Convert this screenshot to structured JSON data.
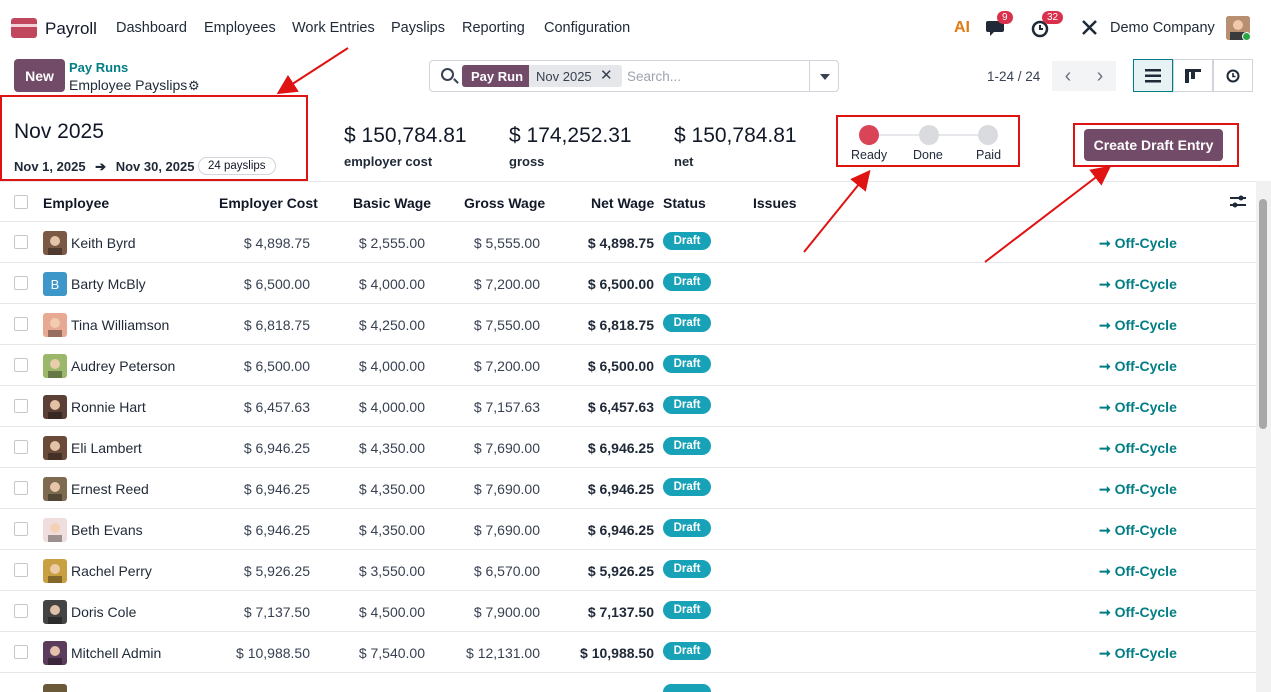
{
  "navbar": {
    "app_name": "Payroll",
    "menu": [
      "Dashboard",
      "Employees",
      "Work Entries",
      "Payslips",
      "Reporting",
      "Configuration"
    ],
    "ai_label": "AI",
    "messages_count": "9",
    "activities_count": "32",
    "company": "Demo Company"
  },
  "control": {
    "new_label": "New",
    "breadcrumb_parent": "Pay Runs",
    "breadcrumb_current": "Employee Payslips",
    "facet_label": "Pay Run",
    "facet_value": "Nov 2025",
    "search_placeholder": "Search...",
    "pager": "1-24 / 24"
  },
  "summary": {
    "title": "Nov 2025",
    "start_date": "Nov 1, 2025",
    "end_date": "Nov 30, 2025",
    "payslip_count": "24 payslips",
    "employer_cost_value": "$ 150,784.81",
    "employer_cost_label": "employer cost",
    "gross_value": "$ 174,252.31",
    "gross_label": "gross",
    "net_value": "$ 150,784.81",
    "net_label": "net",
    "states": [
      "Ready",
      "Done",
      "Paid"
    ],
    "active_state": "Ready",
    "create_draft_label": "Create Draft Entry"
  },
  "table": {
    "columns": [
      "Employee",
      "Employer Cost",
      "Basic Wage",
      "Gross Wage",
      "Net Wage",
      "Status",
      "Issues"
    ],
    "rows": [
      {
        "employee": "Keith Byrd",
        "employer_cost": "$ 4,898.75",
        "basic": "$ 2,555.00",
        "gross": "$ 5,555.00",
        "net": "$ 4,898.75",
        "status": "Draft",
        "action": "Off-Cycle"
      },
      {
        "employee": "Barty McBly",
        "employer_cost": "$ 6,500.00",
        "basic": "$ 4,000.00",
        "gross": "$ 7,200.00",
        "net": "$ 6,500.00",
        "status": "Draft",
        "action": "Off-Cycle",
        "initial": "B"
      },
      {
        "employee": "Tina Williamson",
        "employer_cost": "$ 6,818.75",
        "basic": "$ 4,250.00",
        "gross": "$ 7,550.00",
        "net": "$ 6,818.75",
        "status": "Draft",
        "action": "Off-Cycle"
      },
      {
        "employee": "Audrey Peterson",
        "employer_cost": "$ 6,500.00",
        "basic": "$ 4,000.00",
        "gross": "$ 7,200.00",
        "net": "$ 6,500.00",
        "status": "Draft",
        "action": "Off-Cycle"
      },
      {
        "employee": "Ronnie Hart",
        "employer_cost": "$ 6,457.63",
        "basic": "$ 4,000.00",
        "gross": "$ 7,157.63",
        "net": "$ 6,457.63",
        "status": "Draft",
        "action": "Off-Cycle"
      },
      {
        "employee": "Eli Lambert",
        "employer_cost": "$ 6,946.25",
        "basic": "$ 4,350.00",
        "gross": "$ 7,690.00",
        "net": "$ 6,946.25",
        "status": "Draft",
        "action": "Off-Cycle"
      },
      {
        "employee": "Ernest Reed",
        "employer_cost": "$ 6,946.25",
        "basic": "$ 4,350.00",
        "gross": "$ 7,690.00",
        "net": "$ 6,946.25",
        "status": "Draft",
        "action": "Off-Cycle"
      },
      {
        "employee": "Beth Evans",
        "employer_cost": "$ 6,946.25",
        "basic": "$ 4,350.00",
        "gross": "$ 7,690.00",
        "net": "$ 6,946.25",
        "status": "Draft",
        "action": "Off-Cycle"
      },
      {
        "employee": "Rachel Perry",
        "employer_cost": "$ 5,926.25",
        "basic": "$ 3,550.00",
        "gross": "$ 6,570.00",
        "net": "$ 5,926.25",
        "status": "Draft",
        "action": "Off-Cycle"
      },
      {
        "employee": "Doris Cole",
        "employer_cost": "$ 7,137.50",
        "basic": "$ 4,500.00",
        "gross": "$ 7,900.00",
        "net": "$ 7,137.50",
        "status": "Draft",
        "action": "Off-Cycle"
      },
      {
        "employee": "Mitchell Admin",
        "employer_cost": "$ 10,988.50",
        "basic": "$ 7,540.00",
        "gross": "$ 12,131.00",
        "net": "$ 10,988.50",
        "status": "Draft",
        "action": "Off-Cycle"
      }
    ]
  },
  "colors": {
    "brand": "#714b67",
    "accent": "#017e84",
    "draft_badge": "#17a2b8",
    "annotation": "#e01313"
  }
}
